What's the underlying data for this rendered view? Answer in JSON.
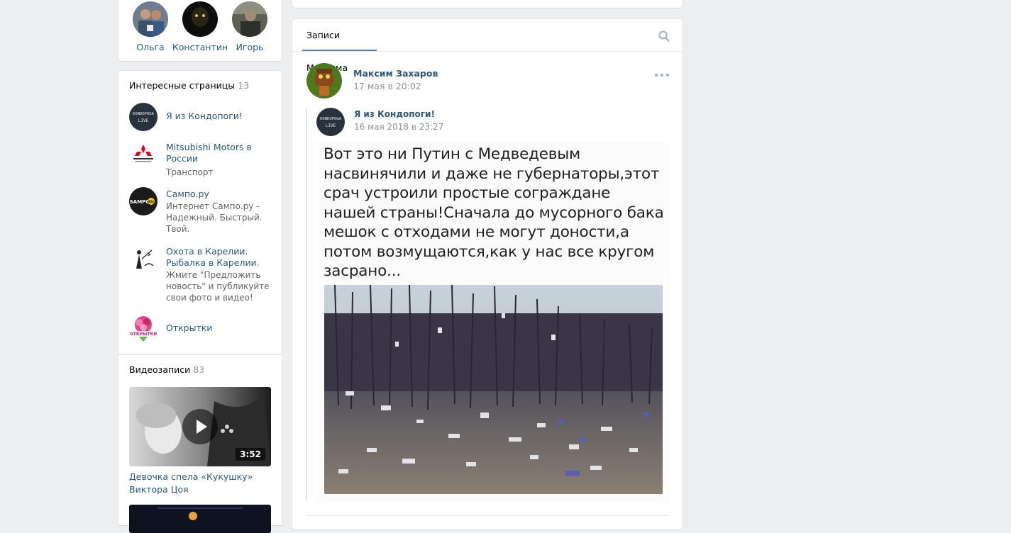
{
  "friends": [
    {
      "name": "Ольга"
    },
    {
      "name": "Константин"
    },
    {
      "name": "Игорь"
    }
  ],
  "interesting_pages": {
    "title": "Интересные страницы",
    "count": "13",
    "items": [
      {
        "title": "Я из Кондопоги!",
        "desc": "",
        "logo_text": "KONDOPOGA LIVE"
      },
      {
        "title": "Mitsubishi Motors в России",
        "desc": "Транспорт",
        "logo_text": "MITSUBISHI MOTORS"
      },
      {
        "title": "Сампо.ру",
        "desc": "Интернет Сампо.ру - Надежный. Быстрый. Твой.",
        "logo_text": "SAMPO.RU"
      },
      {
        "title": "Охота в Карелии. Рыбалка в Карелии.",
        "desc": "Жмите \"Предложить новость\" и публикуйте свои фото и видео!",
        "logo_text": ""
      },
      {
        "title": "Открытки",
        "desc": "",
        "logo_text": "ОТКРЫТКИ"
      }
    ]
  },
  "videos": {
    "title": "Видеозаписи",
    "count": "83",
    "items": [
      {
        "title": "Девочка спела «Кукушку» Виктора Цоя",
        "duration": "3:52"
      }
    ]
  },
  "wall": {
    "tab_label": "Записи Максима",
    "post": {
      "author": "Максим Захаров",
      "date": "17 мая в 20:02",
      "repost": {
        "author": "Я из Кондопоги!",
        "date": "16 мая 2018 в 23:27",
        "image_text": "Вот это ни Путин с Медведевым насвинячили и даже не губернаторы,этот срач устроили простые сограждане нашей страны!Сначала до мусорного бака мешок с отходами не могут доности,а потом возмущаются,как у нас все кругом засрано..."
      }
    }
  },
  "colors": {
    "background": "#edeef0",
    "link": "#2a5885",
    "muted": "#939393",
    "accent": "#5181b8"
  },
  "icons": [
    "search-icon",
    "more-icon",
    "play-icon"
  ]
}
